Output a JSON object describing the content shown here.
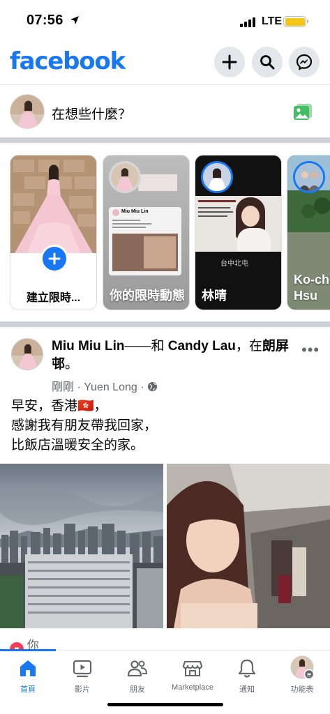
{
  "status": {
    "time": "07:56",
    "network": "LTE"
  },
  "header": {
    "logo": "facebook",
    "icons": [
      "plus-icon",
      "search-icon",
      "messenger-icon"
    ]
  },
  "composer": {
    "placeholder": "在想些什麼？"
  },
  "stories": [
    {
      "label": "建立限時..."
    },
    {
      "label": "你的限時動態",
      "inner_name": "Miu Miu Lin"
    },
    {
      "label": "林晴",
      "inner_caption": "台中北屯"
    },
    {
      "label": "Ko-cheung Hsu"
    }
  ],
  "post": {
    "author": "Miu Miu Lin",
    "connector": "——和 ",
    "tagged": "Candy Lau",
    "location_prefix": "，在",
    "location": "朗屏邨",
    "suffix": "。",
    "time": "剛剛",
    "place": "Yuen Long",
    "text_lines": [
      "早安，香港🇭🇰，",
      "感謝我有朋友帶我回家，",
      "比飯店溫暖安全的家。"
    ],
    "reaction": "你"
  },
  "tabbar": [
    {
      "label": "首頁",
      "active": true
    },
    {
      "label": "影片"
    },
    {
      "label": "朋友"
    },
    {
      "label": "Marketplace"
    },
    {
      "label": "通知"
    },
    {
      "label": "功能表"
    }
  ],
  "colors": {
    "brand": "#1877f2",
    "active_tab": "#1877f2",
    "separator": "#cfd1d6"
  }
}
